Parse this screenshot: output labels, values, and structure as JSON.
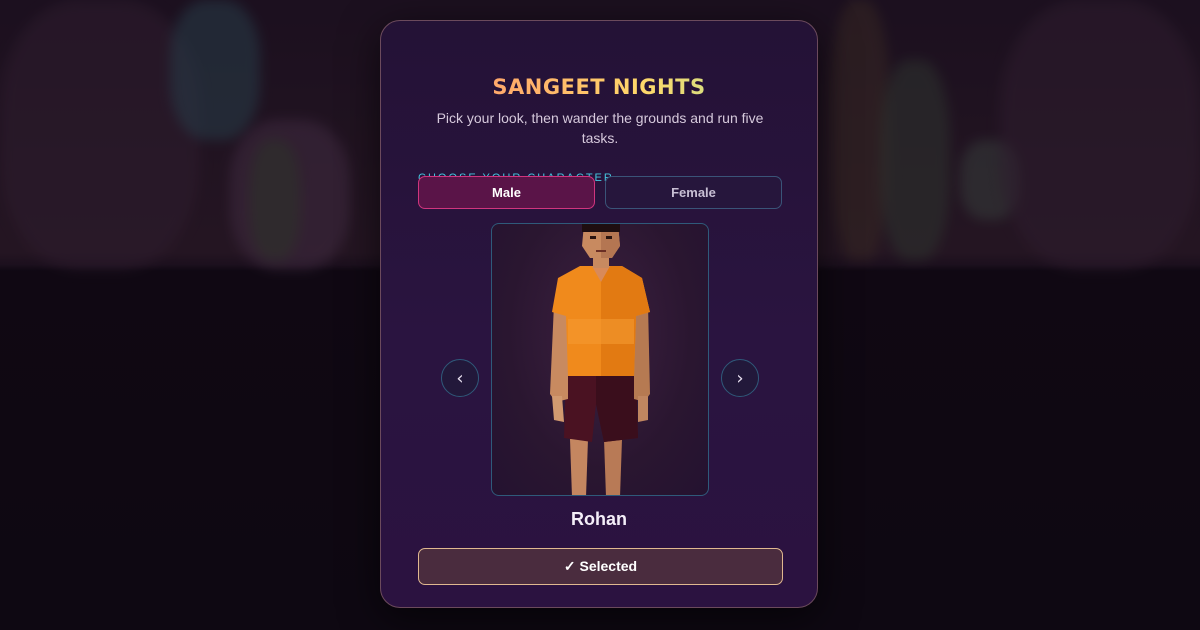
{
  "app": {
    "title": "SANGEET NIGHTS",
    "subtitle": "Pick your look, then wander the grounds and run five tasks."
  },
  "character_select": {
    "section_label": "CHOOSE YOUR CHARACTER",
    "gender_options": [
      {
        "label": "Male",
        "selected": true
      },
      {
        "label": "Female",
        "selected": false
      }
    ],
    "prev_label": "‹",
    "next_label": "›",
    "character_name": "Rohan",
    "select_button_label": "✓ Selected"
  },
  "icons": {
    "prev": "chevron-left-icon",
    "next": "chevron-right-icon"
  },
  "colors": {
    "accent_pink": "#d0357e",
    "accent_cyan": "#45c8e0",
    "shirt_orange": "#f08a1c"
  }
}
